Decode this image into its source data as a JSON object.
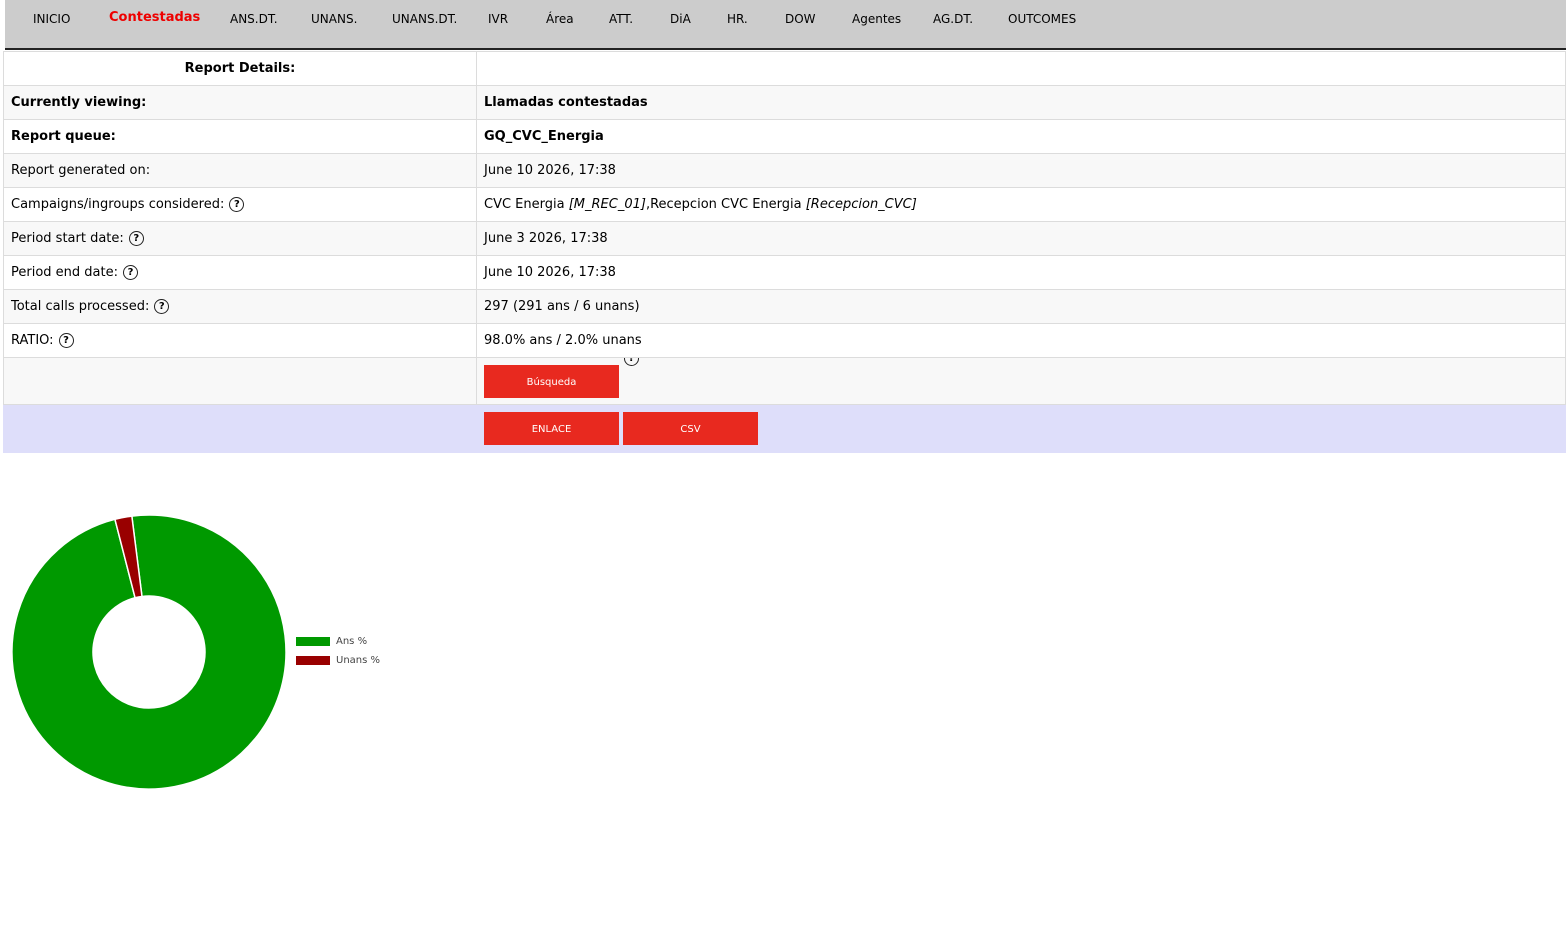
{
  "nav": {
    "tabs": [
      "INICIO",
      "Contestadas",
      "ANS.DT.",
      "UNANS.",
      "UNANS.DT.",
      "IVR",
      "Área",
      "ATT.",
      "DiA",
      "HR.",
      "DOW",
      "Agentes",
      "AG.DT.",
      "OUTCOMES"
    ],
    "active": "Contestadas"
  },
  "details": {
    "header": "Report Details:",
    "currently_viewing_label": "Currently viewing:",
    "currently_viewing_value": "Llamadas contestadas",
    "report_queue_label": "Report queue:",
    "report_queue_value": "GQ_CVC_Energia",
    "generated_label": "Report generated on:",
    "generated_value": "June 10 2026, 17:38",
    "campaigns_label": "Campaigns/ingroups considered:",
    "campaign1_name": "CVC Energia",
    "campaign1_id": "[M_REC_01]",
    "campaign2_name": ",Recepcion CVC Energia",
    "campaign2_id": "[Recepcion_CVC]",
    "start_label": "Period start date:",
    "start_value": "June 3 2026, 17:38",
    "end_label": "Period end date:",
    "end_value": "June 10 2026, 17:38",
    "total_label": "Total calls processed:",
    "total_value": "297 (291 ans / 6 unans)",
    "ratio_label": "RATIO:",
    "ratio_value": "98.0% ans / 2.0% unans",
    "help_glyph": "?"
  },
  "buttons": {
    "search": "Búsqueda",
    "link": "ENLACE",
    "csv": "CSV"
  },
  "colors": {
    "accent_red": "#e8291f",
    "active_tab": "#ee0000",
    "ans": "#009900",
    "unans": "#990000",
    "actions_bg": "#dedefa"
  },
  "chart_data": {
    "type": "pie",
    "donut": true,
    "labels": [
      "Ans %",
      "Unans %"
    ],
    "values": [
      98.0,
      2.0
    ],
    "colors": [
      "#009900",
      "#990000"
    ],
    "legend": "right"
  }
}
